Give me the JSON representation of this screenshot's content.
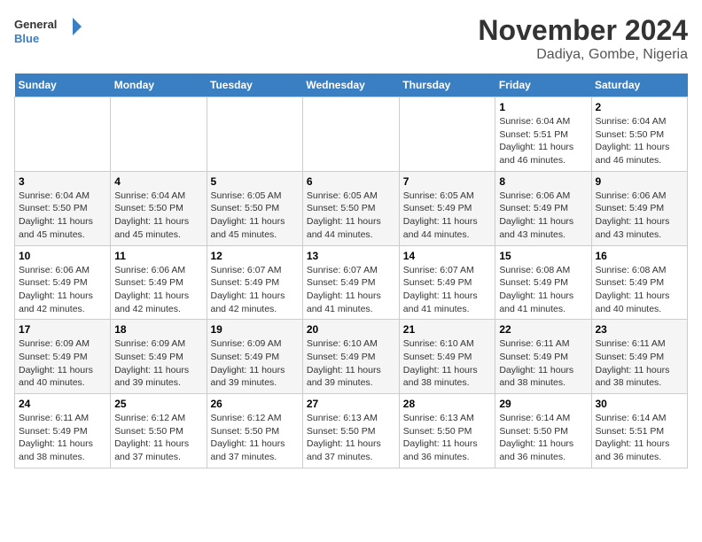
{
  "header": {
    "logo_line1": "General",
    "logo_line2": "Blue",
    "month_year": "November 2024",
    "location": "Dadiya, Gombe, Nigeria"
  },
  "days_of_week": [
    "Sunday",
    "Monday",
    "Tuesday",
    "Wednesday",
    "Thursday",
    "Friday",
    "Saturday"
  ],
  "weeks": [
    [
      {
        "day": "",
        "text": ""
      },
      {
        "day": "",
        "text": ""
      },
      {
        "day": "",
        "text": ""
      },
      {
        "day": "",
        "text": ""
      },
      {
        "day": "",
        "text": ""
      },
      {
        "day": "1",
        "text": "Sunrise: 6:04 AM\nSunset: 5:51 PM\nDaylight: 11 hours and 46 minutes."
      },
      {
        "day": "2",
        "text": "Sunrise: 6:04 AM\nSunset: 5:50 PM\nDaylight: 11 hours and 46 minutes."
      }
    ],
    [
      {
        "day": "3",
        "text": "Sunrise: 6:04 AM\nSunset: 5:50 PM\nDaylight: 11 hours and 45 minutes."
      },
      {
        "day": "4",
        "text": "Sunrise: 6:04 AM\nSunset: 5:50 PM\nDaylight: 11 hours and 45 minutes."
      },
      {
        "day": "5",
        "text": "Sunrise: 6:05 AM\nSunset: 5:50 PM\nDaylight: 11 hours and 45 minutes."
      },
      {
        "day": "6",
        "text": "Sunrise: 6:05 AM\nSunset: 5:50 PM\nDaylight: 11 hours and 44 minutes."
      },
      {
        "day": "7",
        "text": "Sunrise: 6:05 AM\nSunset: 5:49 PM\nDaylight: 11 hours and 44 minutes."
      },
      {
        "day": "8",
        "text": "Sunrise: 6:06 AM\nSunset: 5:49 PM\nDaylight: 11 hours and 43 minutes."
      },
      {
        "day": "9",
        "text": "Sunrise: 6:06 AM\nSunset: 5:49 PM\nDaylight: 11 hours and 43 minutes."
      }
    ],
    [
      {
        "day": "10",
        "text": "Sunrise: 6:06 AM\nSunset: 5:49 PM\nDaylight: 11 hours and 42 minutes."
      },
      {
        "day": "11",
        "text": "Sunrise: 6:06 AM\nSunset: 5:49 PM\nDaylight: 11 hours and 42 minutes."
      },
      {
        "day": "12",
        "text": "Sunrise: 6:07 AM\nSunset: 5:49 PM\nDaylight: 11 hours and 42 minutes."
      },
      {
        "day": "13",
        "text": "Sunrise: 6:07 AM\nSunset: 5:49 PM\nDaylight: 11 hours and 41 minutes."
      },
      {
        "day": "14",
        "text": "Sunrise: 6:07 AM\nSunset: 5:49 PM\nDaylight: 11 hours and 41 minutes."
      },
      {
        "day": "15",
        "text": "Sunrise: 6:08 AM\nSunset: 5:49 PM\nDaylight: 11 hours and 41 minutes."
      },
      {
        "day": "16",
        "text": "Sunrise: 6:08 AM\nSunset: 5:49 PM\nDaylight: 11 hours and 40 minutes."
      }
    ],
    [
      {
        "day": "17",
        "text": "Sunrise: 6:09 AM\nSunset: 5:49 PM\nDaylight: 11 hours and 40 minutes."
      },
      {
        "day": "18",
        "text": "Sunrise: 6:09 AM\nSunset: 5:49 PM\nDaylight: 11 hours and 39 minutes."
      },
      {
        "day": "19",
        "text": "Sunrise: 6:09 AM\nSunset: 5:49 PM\nDaylight: 11 hours and 39 minutes."
      },
      {
        "day": "20",
        "text": "Sunrise: 6:10 AM\nSunset: 5:49 PM\nDaylight: 11 hours and 39 minutes."
      },
      {
        "day": "21",
        "text": "Sunrise: 6:10 AM\nSunset: 5:49 PM\nDaylight: 11 hours and 38 minutes."
      },
      {
        "day": "22",
        "text": "Sunrise: 6:11 AM\nSunset: 5:49 PM\nDaylight: 11 hours and 38 minutes."
      },
      {
        "day": "23",
        "text": "Sunrise: 6:11 AM\nSunset: 5:49 PM\nDaylight: 11 hours and 38 minutes."
      }
    ],
    [
      {
        "day": "24",
        "text": "Sunrise: 6:11 AM\nSunset: 5:49 PM\nDaylight: 11 hours and 38 minutes."
      },
      {
        "day": "25",
        "text": "Sunrise: 6:12 AM\nSunset: 5:50 PM\nDaylight: 11 hours and 37 minutes."
      },
      {
        "day": "26",
        "text": "Sunrise: 6:12 AM\nSunset: 5:50 PM\nDaylight: 11 hours and 37 minutes."
      },
      {
        "day": "27",
        "text": "Sunrise: 6:13 AM\nSunset: 5:50 PM\nDaylight: 11 hours and 37 minutes."
      },
      {
        "day": "28",
        "text": "Sunrise: 6:13 AM\nSunset: 5:50 PM\nDaylight: 11 hours and 36 minutes."
      },
      {
        "day": "29",
        "text": "Sunrise: 6:14 AM\nSunset: 5:50 PM\nDaylight: 11 hours and 36 minutes."
      },
      {
        "day": "30",
        "text": "Sunrise: 6:14 AM\nSunset: 5:51 PM\nDaylight: 11 hours and 36 minutes."
      }
    ]
  ]
}
